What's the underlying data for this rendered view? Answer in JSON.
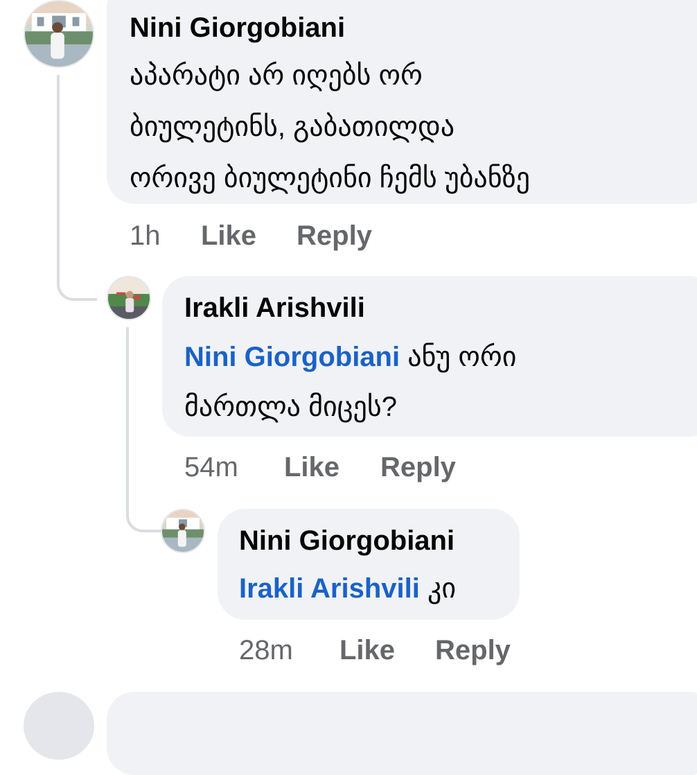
{
  "comments": [
    {
      "author": "Nini Giorgobiani",
      "lines": [
        "აპარატი არ იღებს ორ",
        "ბიულეტინს, გაბათილდა",
        "ორივე ბიულეტინი ჩემს უბანზე"
      ],
      "time": "1h",
      "like": "Like",
      "reply": "Reply"
    },
    {
      "author": "Irakli Arishvili",
      "mention": "Nini Giorgobiani",
      "line1_rest": " ანუ ორი",
      "line2": "მართლა მიცეს?",
      "time": "54m",
      "like": "Like",
      "reply": "Reply"
    },
    {
      "author": "Nini Giorgobiani",
      "mention": "Irakli Arishvili",
      "line1_rest": " კი",
      "time": "28m",
      "like": "Like",
      "reply": "Reply"
    }
  ],
  "colors": {
    "bubble": "#f0f2f5",
    "mention": "#1a62c7",
    "meta": "#65676b",
    "thread_line": "#dadde1"
  }
}
